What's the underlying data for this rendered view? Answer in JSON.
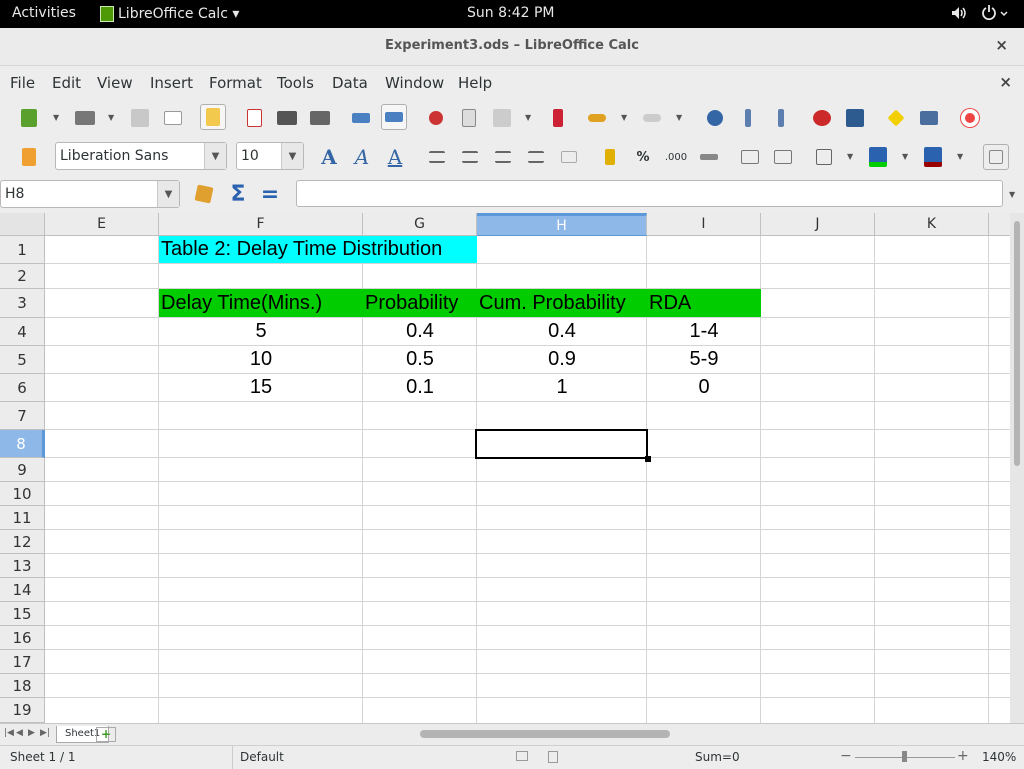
{
  "topbar": {
    "activities": "Activities",
    "app_name": "LibreOffice Calc ▾",
    "clock": "Sun  8:42 PM",
    "volume_icon": "volume-icon",
    "power_icon": "power-icon"
  },
  "window": {
    "title": "Experiment3.ods – LibreOffice Calc",
    "close": "×",
    "doc_close": "×"
  },
  "menu": [
    "File",
    "Edit",
    "View",
    "Insert",
    "Format",
    "Tools",
    "Data",
    "Window",
    "Help"
  ],
  "formatting": {
    "font_name": "Liberation Sans",
    "font_size": "10",
    "percent_label": "%",
    "decimal_label": ".000"
  },
  "formula": {
    "name_box": "H8",
    "content": "",
    "sum_label": "Σ",
    "equals_label": "="
  },
  "columns": [
    "E",
    "F",
    "G",
    "H",
    "I",
    "J",
    "K"
  ],
  "rows": [
    "1",
    "2",
    "3",
    "4",
    "5",
    "6",
    "7",
    "8",
    "9",
    "10",
    "11",
    "12",
    "13",
    "14",
    "15",
    "16",
    "17",
    "18",
    "19"
  ],
  "table": {
    "title": "Table 2: Delay Time Distribution",
    "headers": [
      "Delay Time(Mins.)",
      "Probability",
      "Cum. Probability",
      "RDA"
    ],
    "rows": [
      [
        "5",
        "0.4",
        "0.4",
        "1-4"
      ],
      [
        "10",
        "0.5",
        "0.9",
        "5-9"
      ],
      [
        "15",
        "0.1",
        "1",
        "0"
      ]
    ]
  },
  "selection": {
    "cell": "H8",
    "column": "H",
    "row": "8"
  },
  "colors": {
    "title_bg": "#00ffff",
    "header_bg": "#00cc00",
    "selected_header": "#5d98d8"
  },
  "sheet_tabs": {
    "tab": "Sheet1",
    "add": "+"
  },
  "status": {
    "sheet": "Sheet 1 / 1",
    "style": "Default",
    "sum": "Sum=0",
    "zoom": "140%",
    "zoom_minus": "−",
    "zoom_plus": "+"
  }
}
